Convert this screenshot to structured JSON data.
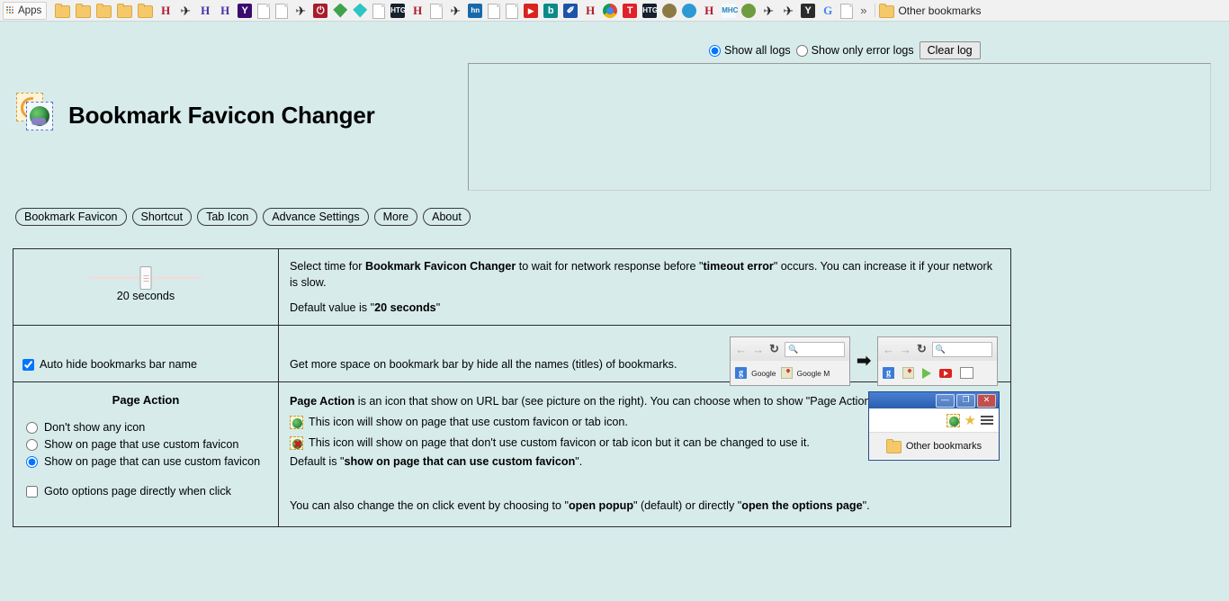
{
  "bookmark_bar": {
    "apps_label": "Apps",
    "overflow_label": "»",
    "other_bookmarks_label": "Other bookmarks",
    "items": [
      {
        "type": "folder",
        "name": "folder-bookmark"
      },
      {
        "type": "folder",
        "name": "folder-bookmark"
      },
      {
        "type": "folder",
        "name": "folder-bookmark"
      },
      {
        "type": "folder",
        "name": "folder-bookmark"
      },
      {
        "type": "folder",
        "name": "folder-bookmark"
      },
      {
        "type": "text",
        "glyph": "H",
        "color": "#b01a2c",
        "name": "h-red-icon"
      },
      {
        "type": "plane",
        "name": "plane-icon"
      },
      {
        "type": "text",
        "glyph": "H",
        "color": "#4b2fa8",
        "name": "h-purple-icon"
      },
      {
        "type": "text",
        "glyph": "H",
        "color": "#4b2fa8",
        "name": "h-purple-icon"
      },
      {
        "type": "box",
        "glyph": "Y",
        "bg": "#3b0a6e",
        "name": "yahoo-icon"
      },
      {
        "type": "doc",
        "name": "page-icon"
      },
      {
        "type": "doc",
        "name": "page-icon"
      },
      {
        "type": "plane",
        "name": "plane-icon"
      },
      {
        "type": "box",
        "glyph": "⏻",
        "bg": "#a81c2b",
        "name": "power-icon"
      },
      {
        "type": "leaf",
        "color": "#3fa34d",
        "name": "leaf-green-icon"
      },
      {
        "type": "leaf",
        "color": "#2ec4c4",
        "name": "leaf-teal-icon"
      },
      {
        "type": "doc",
        "name": "page-icon"
      },
      {
        "type": "box",
        "glyph": "HTG",
        "bg": "#16202e",
        "name": "htg-icon"
      },
      {
        "type": "text",
        "glyph": "H",
        "color": "#b01a2c",
        "name": "h-red-icon"
      },
      {
        "type": "doc",
        "name": "page-icon"
      },
      {
        "type": "plane",
        "name": "plane-icon"
      },
      {
        "type": "box",
        "glyph": "hn",
        "bg": "#1769aa",
        "name": "hn-icon"
      },
      {
        "type": "doc",
        "name": "page-icon"
      },
      {
        "type": "doc",
        "name": "page-icon"
      },
      {
        "type": "yt",
        "name": "youtube-icon"
      },
      {
        "type": "box",
        "glyph": "b",
        "bg": "#0c8a8a",
        "name": "bing-icon"
      },
      {
        "type": "box",
        "glyph": "✐",
        "bg": "#1b55a8",
        "name": "blue-pen-icon"
      },
      {
        "type": "text",
        "glyph": "H",
        "color": "#b01a2c",
        "name": "h-red-icon"
      },
      {
        "type": "chrome",
        "name": "chrome-icon"
      },
      {
        "type": "box",
        "glyph": "T",
        "bg": "#e0202b",
        "name": "t-red-icon"
      },
      {
        "type": "box",
        "glyph": "HTG",
        "bg": "#16202e",
        "name": "htg-icon"
      },
      {
        "type": "circ",
        "color": "#8c7a46",
        "name": "compass-icon"
      },
      {
        "type": "circ",
        "color": "#2d9ad4",
        "name": "cc-icon"
      },
      {
        "type": "text",
        "glyph": "H",
        "color": "#b01a2c",
        "name": "h-red-icon"
      },
      {
        "type": "box",
        "glyph": "MHC",
        "bg": "#f2fbff",
        "fg": "#2c7fb8",
        "name": "mhc-icon"
      },
      {
        "type": "circ",
        "color": "#6f9c3f",
        "name": "globe-green-icon"
      },
      {
        "type": "plane",
        "name": "plane-icon"
      },
      {
        "type": "plane",
        "name": "plane-icon"
      },
      {
        "type": "box",
        "glyph": "Y",
        "bg": "#2b2b2b",
        "name": "y-dark-icon"
      },
      {
        "type": "google",
        "name": "google-icon"
      },
      {
        "type": "doc",
        "name": "page-icon"
      }
    ]
  },
  "log": {
    "show_all_label": "Show all logs",
    "show_all_checked": true,
    "show_errors_label": "Show only error logs",
    "show_errors_checked": false,
    "clear_button": "Clear log",
    "content": ""
  },
  "header": {
    "title": "Bookmark Favicon Changer",
    "icon": "bookmark-favicon-changer-logo"
  },
  "tabs": [
    {
      "label": "Bookmark Favicon",
      "active": false
    },
    {
      "label": "Shortcut",
      "active": false
    },
    {
      "label": "Tab Icon",
      "active": false
    },
    {
      "label": "Advance Settings",
      "active": true
    },
    {
      "label": "More",
      "active": false
    },
    {
      "label": "About",
      "active": false
    }
  ],
  "settings": {
    "timeout": {
      "slider_value_label": "20 seconds",
      "slider_value": 20,
      "desc_line1_a": "Select time for ",
      "desc_line1_b": "Bookmark Favicon Changer",
      "desc_line1_c": " to wait for network response before \"",
      "desc_line1_d": "timeout error",
      "desc_line1_e": "\" occurs. You can increase it if your network is slow.",
      "desc_line2_a": "Default value is \"",
      "desc_line2_b": "20 seconds",
      "desc_line2_c": "\""
    },
    "autohide": {
      "checkbox_label": "Auto hide bookmarks bar name",
      "checked": true,
      "description": "Get more space on bookmark bar by hide all the names (titles) of bookmarks.",
      "mock_before": {
        "search_placeholder": "",
        "bookmark1": "Google",
        "bookmark2": "Google M"
      },
      "mock_after": {
        "search_placeholder": ""
      },
      "arrow": "➡"
    },
    "page_action": {
      "title": "Page Action",
      "options": [
        {
          "label": "Don't show any icon",
          "selected": false
        },
        {
          "label": "Show on page that use custom favicon",
          "selected": false
        },
        {
          "label": "Show on page that can use custom favicon",
          "selected": true
        }
      ],
      "goto_options_label": "Goto options page directly when click",
      "goto_options_checked": false,
      "desc1_a": "Page Action",
      "desc1_b": " is an icon that show on URL bar (see picture on the right). You can choose when to show \"Page Action\".",
      "desc2": "This icon will show on page that use custom favicon or tab icon.",
      "desc3": "This icon will show on page that don't use custom favicon or tab icon but it can be changed to use it.",
      "desc4_a": "Default is \"",
      "desc4_b": "show on page that can use custom favicon",
      "desc4_c": "\".",
      "desc5_a": "You can also change the on click event by choosing to \"",
      "desc5_b": "open popup",
      "desc5_c": "\" (default) or directly \"",
      "desc5_d": "open the options page",
      "desc5_e": "\".",
      "window_mock": {
        "minimize": "—",
        "maximize": "❐",
        "close": "✕",
        "other_bookmarks": "Other bookmarks"
      }
    }
  }
}
